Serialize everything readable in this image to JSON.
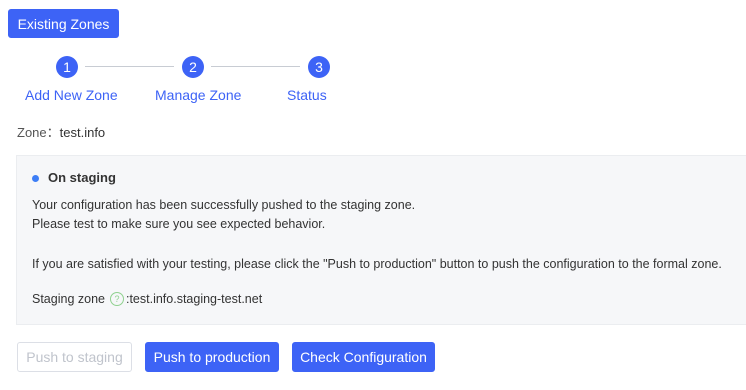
{
  "header": {
    "existing_zones_label": "Existing Zones"
  },
  "steps": [
    {
      "number": "1",
      "label": "Add New Zone"
    },
    {
      "number": "2",
      "label": "Manage Zone"
    },
    {
      "number": "3",
      "label": "Status"
    }
  ],
  "zone": {
    "label": "Zone：",
    "value": "test.info"
  },
  "status_panel": {
    "title": "On staging",
    "status_color": "#3d7ef6",
    "line1": "Your configuration has been successfully pushed to the staging zone.",
    "line2": "Please test to make sure you see expected behavior.",
    "line3": "If you are satisfied with your testing, please click the \"Push to production\" button to push the configuration to the formal zone.",
    "staging_zone_label": "Staging zone",
    "help_icon": "question-circle-icon",
    "staging_zone_value": ":test.info.staging-test.net"
  },
  "actions": {
    "push_staging_label": "Push to staging",
    "push_production_label": "Push to production",
    "check_configuration_label": "Check Configuration"
  },
  "colors": {
    "primary": "#3d63f6",
    "disabled_text": "#c0c4cc",
    "panel_background": "#f6f7f9"
  }
}
